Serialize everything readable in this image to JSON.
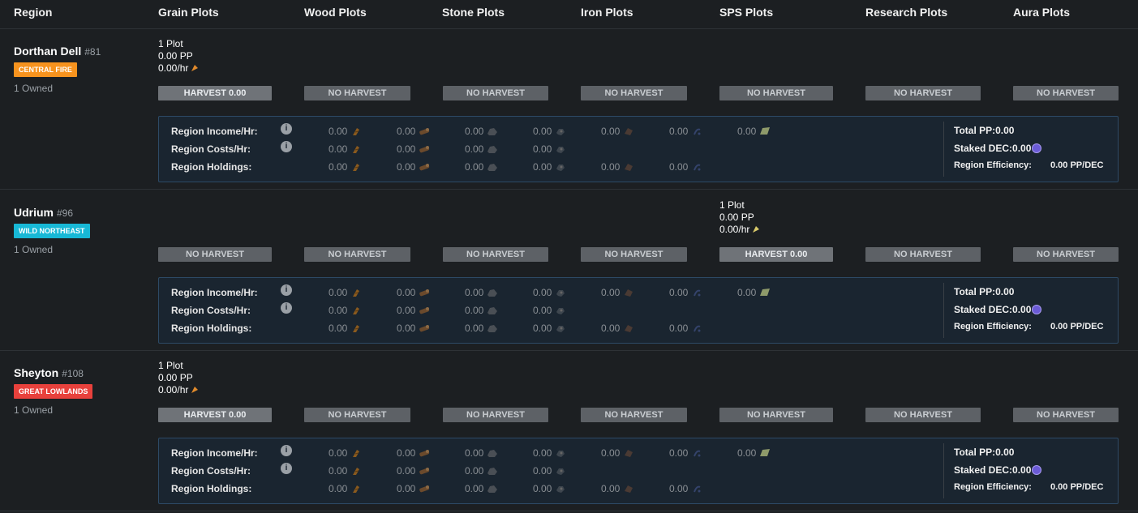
{
  "header": {
    "columns": [
      "Region",
      "Grain Plots",
      "Wood Plots",
      "Stone Plots",
      "Iron Plots",
      "SPS Plots",
      "Research Plots",
      "Aura Plots"
    ]
  },
  "labels": {
    "income": "Region Income/Hr:",
    "costs": "Region Costs/Hr:",
    "holdings": "Region Holdings:",
    "total_pp": "Total PP:0.00",
    "staked_dec": "Staked DEC:0.00",
    "efficiency_label": "Region Efficiency:",
    "efficiency_value": "0.00 PP/DEC",
    "value": "0.00",
    "info_glyph": "i"
  },
  "regions": [
    {
      "name": "Dorthan Dell",
      "number": "#81",
      "tag": "CENTRAL FIRE",
      "tag_color": "#f7931e",
      "owned": "1 Owned",
      "plot": {
        "count": "1 Plot",
        "pp": "0.00 PP",
        "rate": "0.00/hr",
        "column": "grain"
      },
      "buttons": [
        "HARVEST 0.00",
        "NO HARVEST",
        "NO HARVEST",
        "NO HARVEST",
        "NO HARVEST",
        "NO HARVEST",
        "NO HARVEST"
      ]
    },
    {
      "name": "Udrium",
      "number": "#96",
      "tag": "WILD NORTHEAST",
      "tag_color": "#17b8d6",
      "owned": "1 Owned",
      "plot": {
        "count": "1 Plot",
        "pp": "0.00 PP",
        "rate": "0.00/hr",
        "column": "sps"
      },
      "buttons": [
        "NO HARVEST",
        "NO HARVEST",
        "NO HARVEST",
        "NO HARVEST",
        "HARVEST 0.00",
        "NO HARVEST",
        "NO HARVEST"
      ]
    },
    {
      "name": "Sheyton",
      "number": "#108",
      "tag": "GREAT LOWLANDS",
      "tag_color": "#e8413c",
      "owned": "1 Owned",
      "plot": {
        "count": "1 Plot",
        "pp": "0.00 PP",
        "rate": "0.00/hr",
        "column": "grain"
      },
      "buttons": [
        "HARVEST 0.00",
        "NO HARVEST",
        "NO HARVEST",
        "NO HARVEST",
        "NO HARVEST",
        "NO HARVEST",
        "NO HARVEST"
      ]
    }
  ],
  "icons": {
    "grain": "grain-icon",
    "wood": "wood-icon",
    "stone": "stone-icon",
    "iron": "iron-icon",
    "research": "research-icon",
    "aura": "aura-icon",
    "sps": "sps-icon",
    "dec": "dec-icon",
    "info": "info-icon"
  },
  "colors": {
    "background": "#1c1f22",
    "summary_border": "#2d4a66",
    "button": "#5d6166"
  }
}
